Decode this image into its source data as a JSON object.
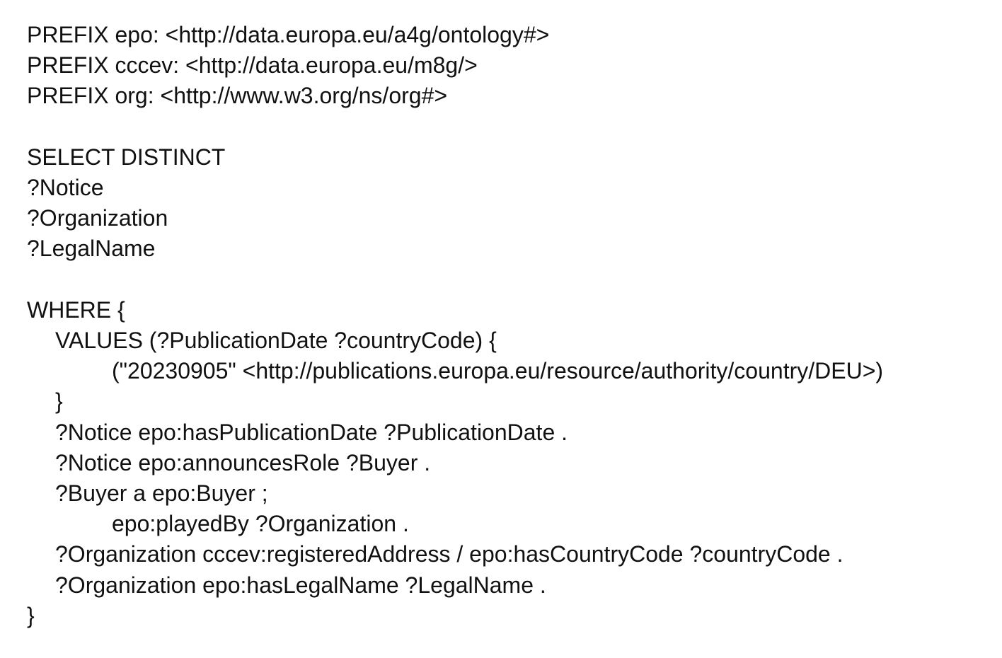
{
  "document": {
    "lines": [
      {
        "text": "PREFIX epo: <http://data.europa.eu/a4g/ontology#>",
        "indent": 0
      },
      {
        "text": "PREFIX cccev: <http://data.europa.eu/m8g/>",
        "indent": 0
      },
      {
        "text": "PREFIX org: <http://www.w3.org/ns/org#>",
        "indent": 0
      },
      {
        "text": "",
        "indent": 0
      },
      {
        "text": "SELECT DISTINCT",
        "indent": 0
      },
      {
        "text": "?Notice",
        "indent": 0
      },
      {
        "text": "?Organization",
        "indent": 0
      },
      {
        "text": "?LegalName",
        "indent": 0
      },
      {
        "text": "",
        "indent": 0
      },
      {
        "text": "WHERE {",
        "indent": 0
      },
      {
        "text": "VALUES (?PublicationDate ?countryCode) {",
        "indent": 1
      },
      {
        "text": "(\"20230905\" <http://publications.europa.eu/resource/authority/country/DEU>)",
        "indent": 2
      },
      {
        "text": "}",
        "indent": 1
      },
      {
        "text": "?Notice epo:hasPublicationDate ?PublicationDate .",
        "indent": 1
      },
      {
        "text": "?Notice epo:announcesRole ?Buyer .",
        "indent": 1
      },
      {
        "text": "?Buyer a epo:Buyer ;",
        "indent": 1
      },
      {
        "text": "epo:playedBy ?Organization .",
        "indent": 2
      },
      {
        "text": "?Organization cccev:registeredAddress / epo:hasCountryCode ?countryCode .",
        "indent": 1
      },
      {
        "text": "?Organization epo:hasLegalName ?LegalName .",
        "indent": 1
      },
      {
        "text": "}",
        "indent": 0
      }
    ]
  }
}
